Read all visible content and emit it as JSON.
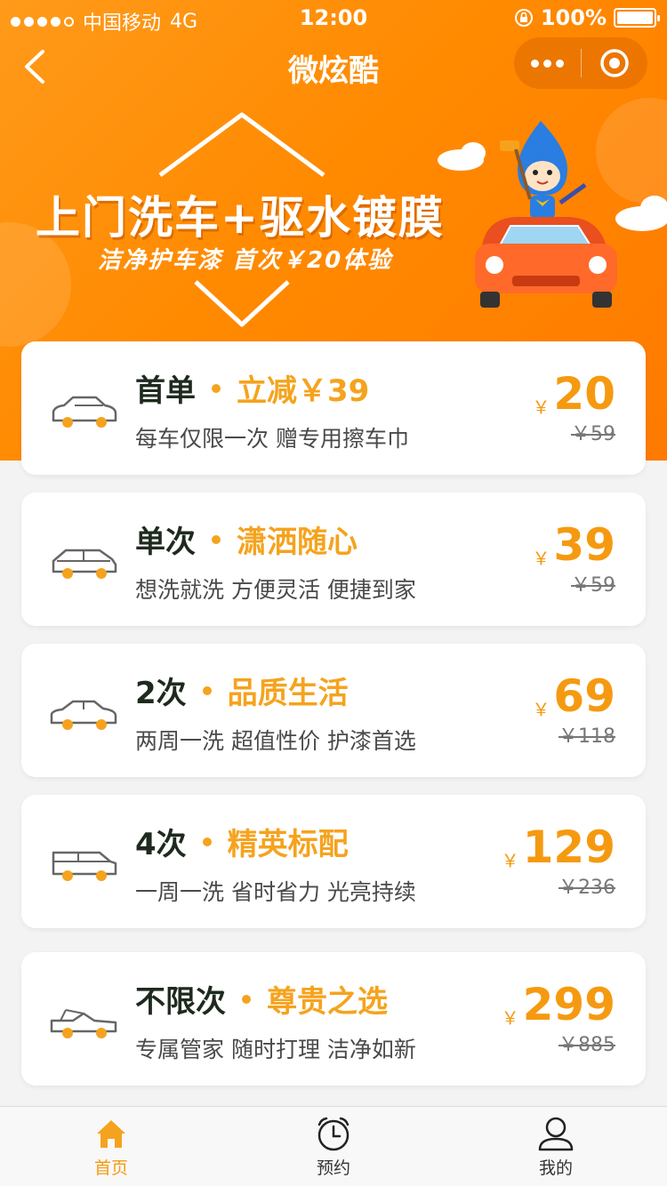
{
  "status_bar": {
    "carrier": "中国移动",
    "network": "4G",
    "time": "12:00",
    "battery": "100%"
  },
  "navbar": {
    "title": "微炫酷",
    "back_icon": "chevron-left-icon",
    "more_icon": "more-dots-icon",
    "close_icon": "target-circle-icon"
  },
  "banner": {
    "title": "上门洗车+驱水镀膜",
    "subtitle": "洁净护车漆 首次￥20体验"
  },
  "plans": [
    {
      "name": "首单",
      "tag": "立减￥39",
      "desc": "每车仅限一次 赠专用擦车巾",
      "currency": "￥",
      "price": "20",
      "original": "￥59",
      "icon": "sedan-icon"
    },
    {
      "name": "单次",
      "tag": "潇洒随心",
      "desc": "想洗就洗 方便灵活 便捷到家",
      "currency": "￥",
      "price": "39",
      "original": "￥59",
      "icon": "hatchback-icon"
    },
    {
      "name": "2次",
      "tag": "品质生活",
      "desc": "两周一洗 超值性价 护漆首选",
      "currency": "￥",
      "price": "69",
      "original": "￥118",
      "icon": "coupe-icon"
    },
    {
      "name": "4次",
      "tag": "精英标配",
      "desc": "一周一洗 省时省力 光亮持续",
      "currency": "￥",
      "price": "129",
      "original": "￥236",
      "icon": "suv-icon"
    },
    {
      "name": "不限次",
      "tag": "尊贵之选",
      "desc": "专属管家 随时打理 洁净如新",
      "currency": "￥",
      "price": "299",
      "original": "￥885",
      "icon": "convertible-icon"
    }
  ],
  "tabbar": {
    "items": [
      {
        "label": "首页",
        "icon": "home-icon",
        "active": true
      },
      {
        "label": "预约",
        "icon": "alarm-clock-icon",
        "active": false
      },
      {
        "label": "我的",
        "icon": "user-icon",
        "active": false
      }
    ]
  },
  "colors": {
    "brand_orange": "#ff8a00",
    "accent": "#f5a31e",
    "price": "#f59a10"
  }
}
